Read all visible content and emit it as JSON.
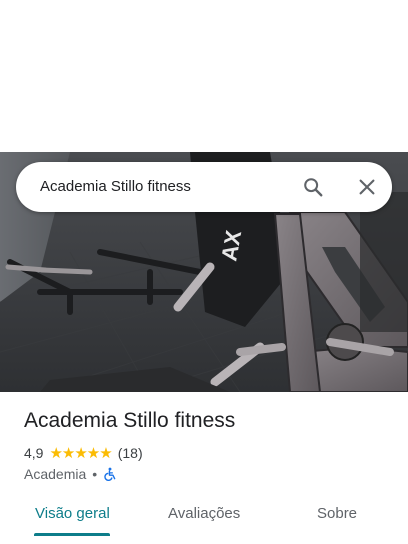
{
  "search": {
    "query": "Academia Stillo fitness",
    "search_icon": "search-icon",
    "close_icon": "close-icon"
  },
  "hero": {
    "image": "gym-equipment-photo",
    "sign_text": "AX"
  },
  "place": {
    "name": "Academia Stillo fitness",
    "rating": "4,9",
    "stars": "★★★★★",
    "review_count": "(18)",
    "category": "Academia",
    "separator": "•",
    "accessibility_icon": "wheelchair-icon"
  },
  "tabs": [
    {
      "label": "Visão geral",
      "active": true
    },
    {
      "label": "Avaliações",
      "active": false
    },
    {
      "label": "Sobre",
      "active": false
    }
  ],
  "colors": {
    "accent": "#0d7d8a",
    "star": "#fbbc04",
    "wheelchair": "#1a73e8"
  }
}
